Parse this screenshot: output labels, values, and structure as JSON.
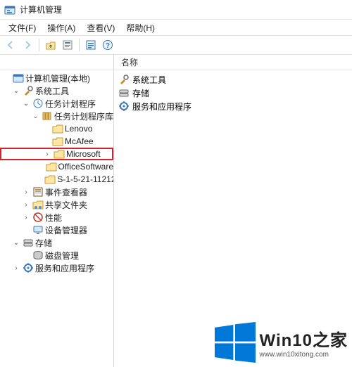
{
  "window": {
    "title": "计算机管理"
  },
  "menu": {
    "file": "文件(F)",
    "action": "操作(A)",
    "view": "查看(V)",
    "help": "帮助(H)"
  },
  "toolbar_icons": {
    "back": "back-arrow-icon",
    "forward": "forward-arrow-icon",
    "up": "up-level-icon",
    "properties": "properties-icon",
    "refresh": "refresh-icon",
    "help": "help-icon"
  },
  "list_header": {
    "name_col": "名称"
  },
  "list_items": [
    {
      "label": "系统工具",
      "icon": "tools-icon"
    },
    {
      "label": "存储",
      "icon": "storage-icon"
    },
    {
      "label": "服务和应用程序",
      "icon": "services-icon"
    }
  ],
  "tree": {
    "root": {
      "label": "计算机管理(本地)"
    },
    "system_tools": {
      "label": "系统工具"
    },
    "task_scheduler": {
      "label": "任务计划程序"
    },
    "task_lib": {
      "label": "任务计划程序库"
    },
    "lenovo": {
      "label": "Lenovo"
    },
    "mcafee": {
      "label": "McAfee"
    },
    "microsoft": {
      "label": "Microsoft"
    },
    "officesoftware": {
      "label": "OfficeSoftware"
    },
    "sid": {
      "label": "S-1-5-21-11212"
    },
    "event_viewer": {
      "label": "事件查看器"
    },
    "shared_folders": {
      "label": "共享文件夹"
    },
    "performance": {
      "label": "性能"
    },
    "device_mgr": {
      "label": "设备管理器"
    },
    "storage": {
      "label": "存储"
    },
    "disk_mgmt": {
      "label": "磁盘管理"
    },
    "services_apps": {
      "label": "服务和应用程序"
    }
  },
  "watermark": {
    "title": "Win10之家",
    "url": "www.win10xitong.com"
  }
}
